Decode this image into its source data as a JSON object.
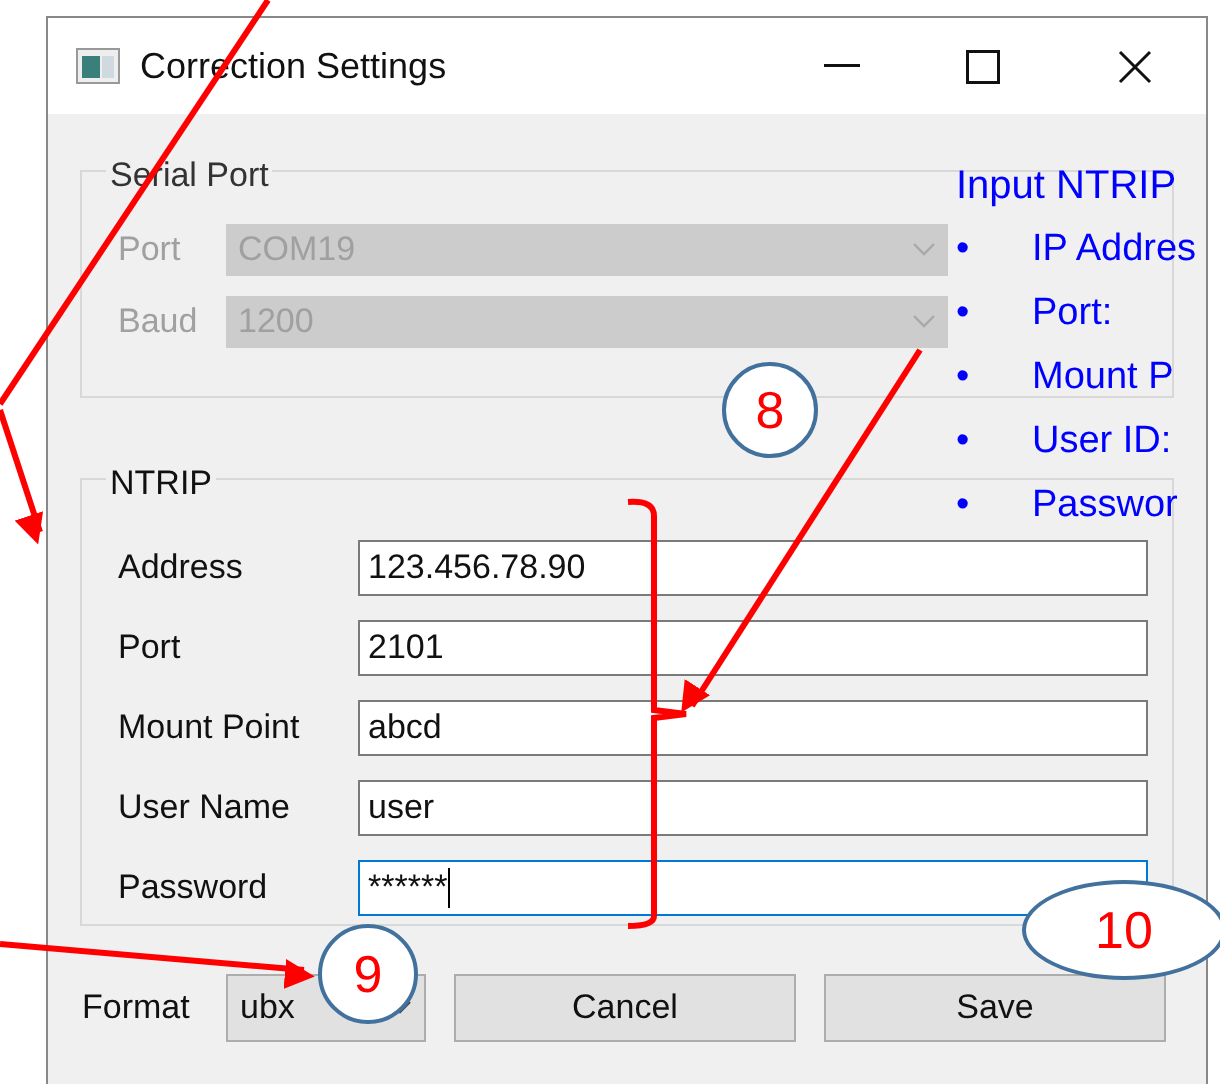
{
  "window": {
    "title": "Correction Settings"
  },
  "serial_port": {
    "title": "Serial Port",
    "disabled": true,
    "fields": [
      {
        "label": "Port",
        "value": "COM19"
      },
      {
        "label": "Baud",
        "value": "1200"
      }
    ]
  },
  "ntrip": {
    "title": "NTRIP",
    "fields": [
      {
        "label": "Address",
        "value": "123.456.78.90",
        "focused": false
      },
      {
        "label": "Port",
        "value": "2101",
        "focused": false
      },
      {
        "label": "Mount Point",
        "value": "abcd",
        "focused": false
      },
      {
        "label": "User Name",
        "value": "user",
        "focused": false
      },
      {
        "label": "Password",
        "value": "******",
        "focused": true
      }
    ]
  },
  "format": {
    "label": "Format",
    "value": "ubx"
  },
  "buttons": [
    "Cancel",
    "Save"
  ],
  "annotations": {
    "callouts": [
      "8",
      "9",
      "10"
    ],
    "note_title": "Input NTRIP",
    "note_items": [
      {
        "bullet": "•",
        "text": "IP Addres"
      },
      {
        "bullet": "•",
        "text": "Port:"
      },
      {
        "bullet": "•",
        "text": "Mount P"
      },
      {
        "bullet": "•",
        "text": "User ID:"
      },
      {
        "bullet": "•",
        "text": "Passwor"
      }
    ]
  }
}
